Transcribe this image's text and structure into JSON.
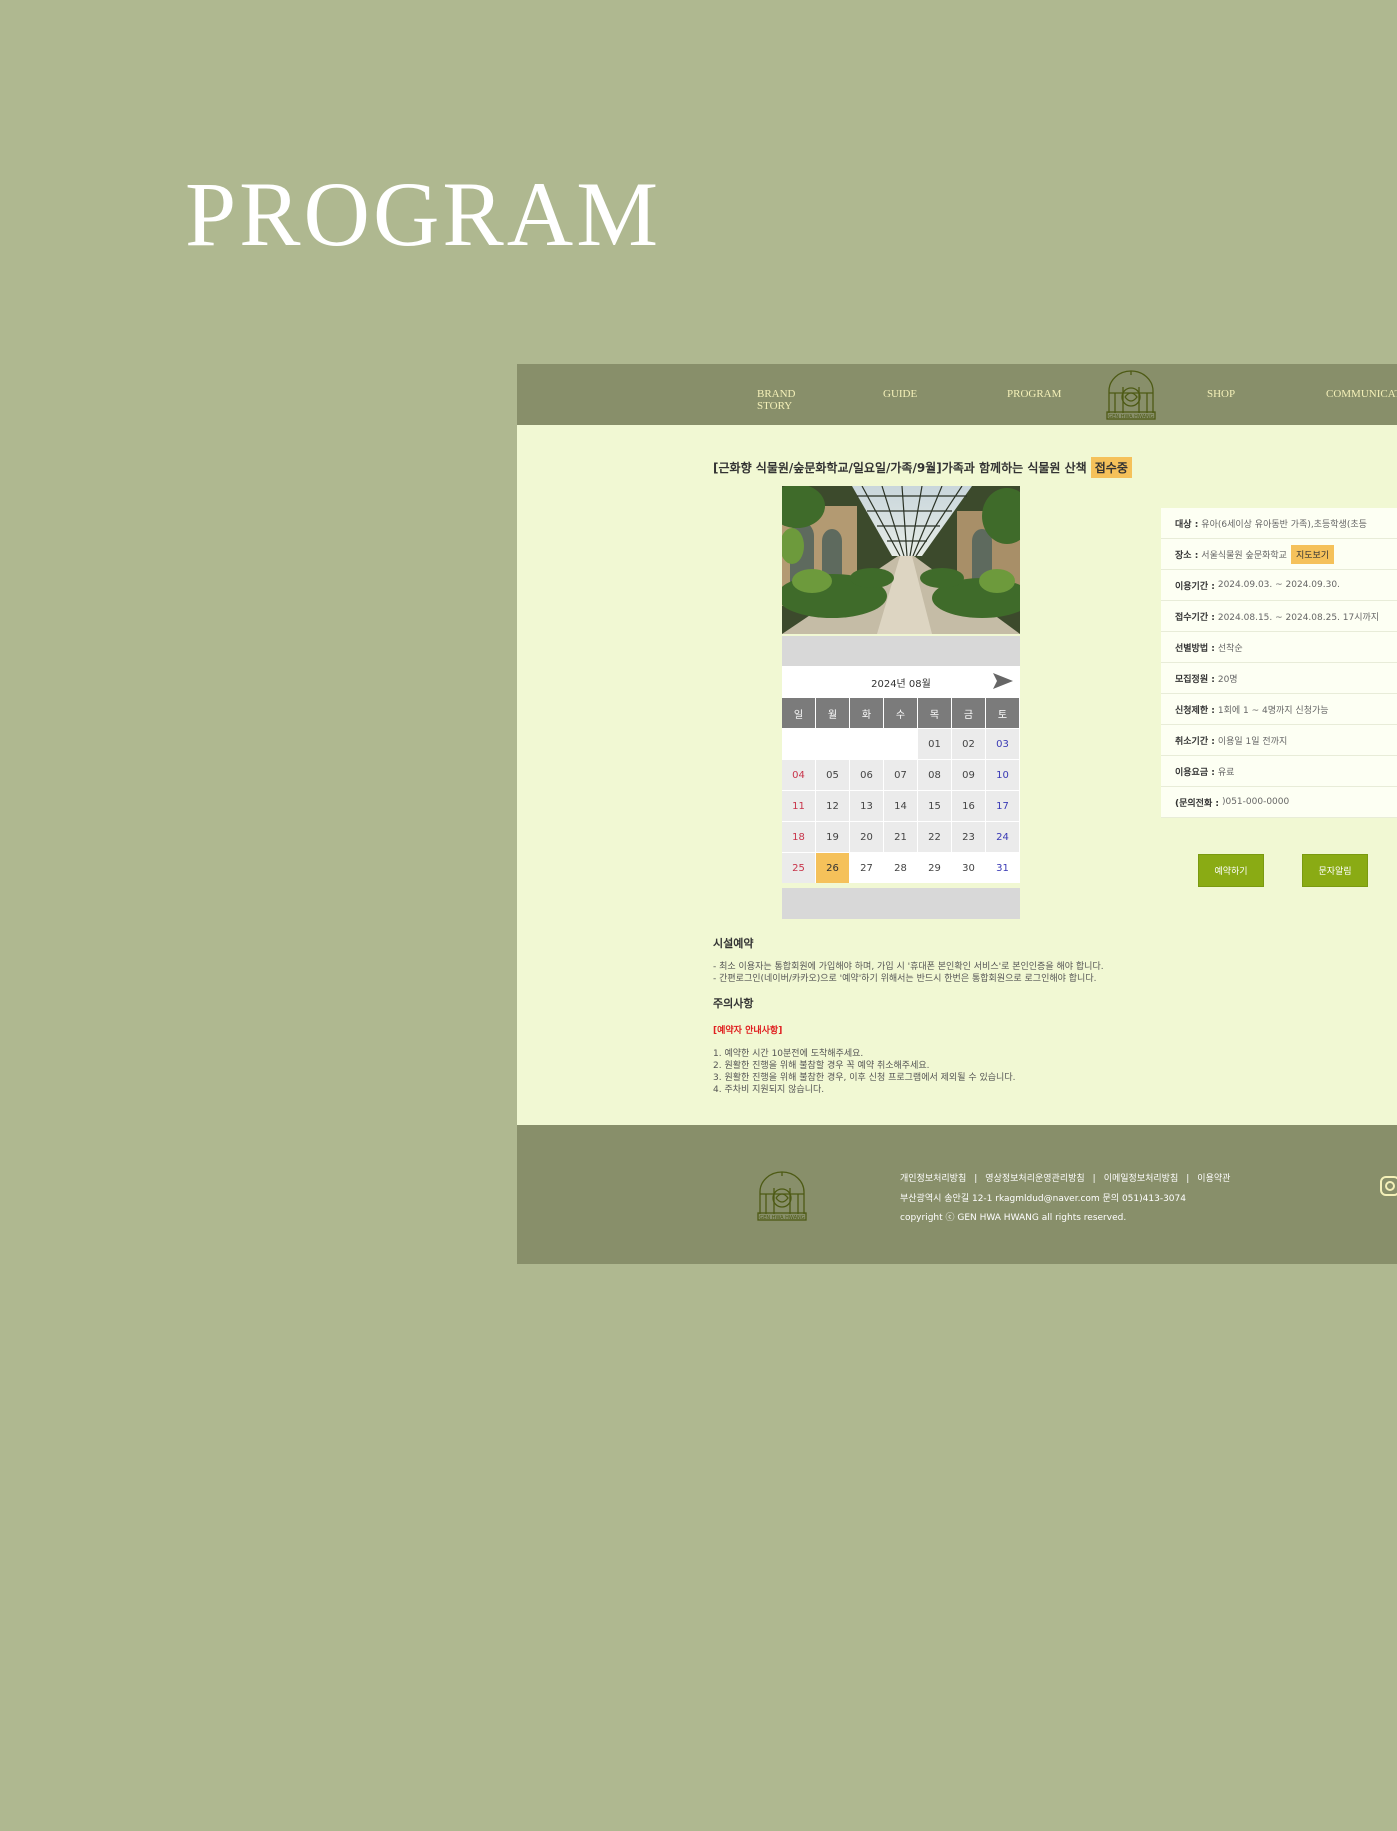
{
  "hero": {
    "title": "PROGRAM"
  },
  "nav": {
    "items": [
      "BRAND\nSTORY",
      "GUIDE",
      "PROGRAM",
      "SHOP",
      "COMMUNICATION"
    ],
    "logo_text": "GEN HWA HWANG"
  },
  "program": {
    "title": "[근화향 식물원/숲문화학교/일요일/가족/9월]가족과 함께하는 식물원 산책",
    "status_badge": "접수중"
  },
  "calendar": {
    "month_label": "2024년 08월",
    "next_icon": "arrow-right-icon",
    "weekdays": [
      "일",
      "월",
      "화",
      "수",
      "목",
      "금",
      "토"
    ],
    "weeks": [
      [
        "",
        "",
        "",
        "",
        "01",
        "02",
        "03"
      ],
      [
        "04",
        "05",
        "06",
        "07",
        "08",
        "09",
        "10"
      ],
      [
        "11",
        "12",
        "13",
        "14",
        "15",
        "16",
        "17"
      ],
      [
        "18",
        "19",
        "20",
        "21",
        "22",
        "23",
        "24"
      ],
      [
        "25",
        "26",
        "27",
        "28",
        "29",
        "30",
        "31"
      ]
    ],
    "today": "26"
  },
  "info": {
    "rows": [
      {
        "label": "대상 :",
        "value": "유아(6세이상 유아동반 가족),초등학생(초등"
      },
      {
        "label": "장소 :",
        "value": "서울식물원 숲문화학교",
        "button": "지도보기"
      },
      {
        "label": "이용기간 :",
        "value": "2024.09.03. ~ 2024.09.30."
      },
      {
        "label": "접수기간 :",
        "value": "2024.08.15. ~ 2024.08.25. 17시까지"
      },
      {
        "label": "선별방법 :",
        "value": "선착순"
      },
      {
        "label": "모집정원 :",
        "value": "20명"
      },
      {
        "label": "신청제한 :",
        "value": "1회에 1 ~ 4명까지 신청가능"
      },
      {
        "label": "취소기간 :",
        "value": "이용일 1일 전까지"
      },
      {
        "label": "이용요금 :",
        "value": "유료"
      },
      {
        "label": "(문의전화 :",
        "value": ")051-000-0000"
      }
    ]
  },
  "actions": {
    "reserve": "예약하기",
    "sms": "문자알림"
  },
  "notes": {
    "facility_title": "시설예약",
    "facility_lines": [
      "- 최소 이용자는 통합회원에 가입해야 하며, 가입 시 '휴대폰 본인확인 서비스'로 본인인증을 해야 합니다.",
      "- 간편로그인(네이버/카카오)으로 '예약'하기 위해서는 반드시 한번은 통합회원으로 로그인해야 합니다."
    ],
    "caution_title": "주의사항",
    "warning_label": "[예약자 안내사항]",
    "caution_lines": [
      "1. 예약한 시간 10분전에 도착해주세요.",
      "2. 원활한 진행을 위해 불참할 경우 꼭 예약 취소해주세요.",
      "3. 원활한 진행을 위해 불참한 경우, 이후 신청 프로그램에서 제외될 수 있습니다.",
      "4. 주차비 지원되지 않습니다."
    ]
  },
  "footer": {
    "links": [
      "개인정보처리방침",
      "영상정보처리운영관리방침",
      "이메일정보처리방침",
      "이용약관"
    ],
    "address": "부산광역시 송안길 12-1 rkagmldud@naver.com 문의 051)413-3074",
    "copyright": "copyright ⓒ GEN HWA HWANG all rights reserved.",
    "logo_text": "GEN HWA HWANG"
  },
  "colors": {
    "background": "#afb890",
    "header": "#888f6a",
    "content": "#f1f8d3",
    "accent": "#f5c15a",
    "button": "#8aab14"
  }
}
